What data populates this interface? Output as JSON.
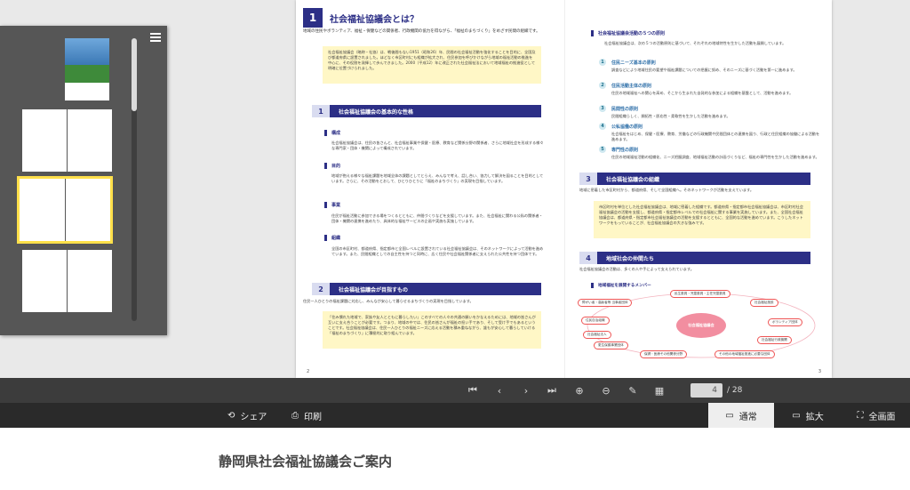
{
  "left_page": {
    "heading_num": "1",
    "heading": "社会福祉協議会とは？",
    "lead": "地域の住民やボランティア、福祉・保健などの関係者、行政機関の協力を得ながら、「福祉のまちづくり」をめざす民間の組織です。",
    "yellow_text": "社会福祉協議会（略称・社協）は、戦後間もない1951（昭和26）年、民間の社会福祉活動を強化することを目的に、全国及び都道府県に設置されました。ほどなく市区町村にも組織が拡大され、住民参加を呼びかけながら地域の福祉活動の推進を中心に、その役割を発揮して歩んできました。2000（平成12）年に改正された社会福祉法において地域福祉の推進役として明確に位置づけられました。",
    "sec1_num": "1",
    "sec1_title": "社会福祉協議会の基本的な性格",
    "sub1": "構成",
    "sub1_text": "社会福祉協議会は、住民の皆さんと、社会福祉事業や保健・医療、教育など関係分野の関係者、さらに地域社会を形成する様々な専門家・団体・機関によって構成されています。",
    "sub2": "目的",
    "sub2_text": "地域が抱える様々な福祉課題を地域全体の課題としてとらえ、みんなで考え、話し合い、協力して解決を図ることを目的としています。さらに、その活動をとおして、ひとりひとりに「福祉のまちづくり」の実現を目指しています。",
    "sub3": "事業",
    "sub3_text": "住民が福祉活動に参加できる場をつくるとともに、仲間づくりなどを支援しています。また、社会福祉に関わる公私の関係者・団体・機関の連携を進めたり、具体的な福祉サービスの企画や実施も実施しています。",
    "sub4": "組織",
    "sub4_text": "全国の市区町村、都道府県、指定都市と全国レベルに設置されている社会福祉協議会は、そのネットワークによって活動を進めています。また、民間組織としての自主性を持つと同時に、広く住民や社会福祉関係者に支えられた公共性を持つ団体です。",
    "sec2_num": "2",
    "sec2_title": "社会福祉協議会が目指すもの",
    "sec2_lead": "住民一人ひとりの福祉課題に対応し、みんなが安心して暮らせるまちづくりの実現を目指しています。",
    "yellow2_text": "「住み慣れた地域で、家族や友人とともに暮らしたい」このすべての人々の共通の願いをかなえるためには、地域の皆さんが互いに支え合うことが必要です。つまり、地域の中では、住民の皆さんが福祉の担い手であり、そして受け手でもあるということです。社会福祉協議会は、住民一人ひとりの福祉ニーズに応える活動を積み重ねながら、誰もが安心して暮らしていける「福祉のまちづくり」に積極的に取り組んでいます。",
    "page_number": "2"
  },
  "right_page": {
    "sec_principle": "社会福祉協議会活動の５つの原則",
    "principle_lead": "社会福祉協議会は、次の５つの活動原則に基づいて、それぞれの地域特性を生かした活動を展開しています。",
    "principles": [
      {
        "num": "1",
        "label": "住民ニーズ基本の原則",
        "text": "調査などにより地域住民の要望や福祉課題についての把握に努め、そのニーズに基づく活動を第一に進めます。"
      },
      {
        "num": "2",
        "label": "住民活動主体の原則",
        "text": "住民の地域福祉への関心を高め、そこから生まれた自発的な参加による組織を基盤として、活動を進めます。"
      },
      {
        "num": "3",
        "label": "民間性の原則",
        "text": "民間組織らしく、開拓性・即応性・柔軟性を生かした活動を進めます。"
      },
      {
        "num": "4",
        "label": "公私協働の原則",
        "text": "社会福祉をはじめ、保健・医療、教育、労働などの行政機関や民間団体との連携を図り、行政と住民組織の協働による活動を進めます。"
      },
      {
        "num": "5",
        "label": "専門性の原則",
        "text": "住民の地域福祉活動の組織化、ニーズ把握調査、地域福祉活動の計画づくりなど、福祉の専門性を生かした活動を進めます。"
      }
    ],
    "sec3_num": "3",
    "sec3_title": "社会福祉協議会の組織",
    "sec3_lead": "地域に密着した市区町村から、都道府県、そして全国組織へ。そのネットワークが活動を支えています。",
    "yellow3_text": "市区町村を単位とした社会福祉協議会は、地域に密着した組織です。都道府県・指定都市社会福祉協議会は、市区町村社会福祉協議会の活動を支援し、都道府県・指定都市レベルでの社会福祉に関する事業を実施しています。また、全国社会福祉協議会は、都道府県・指定都市社会福祉協議会の活動を支援するとともに、全国的な活動を進めています。こうしたネットワークをもっていることが、社会福祉協議会の大きな強みです。",
    "sec4_num": "4",
    "sec4_title": "地域社会の仲間たち",
    "sec4_lead": "社会福祉協議会の活動は、多くの人や手によって支えられています。",
    "map_title": "地域福祉を展開するメンバー",
    "map_center": "社会福祉協議会",
    "map_nodes": [
      "民生委員・児童委員・主任児童委員",
      "社会福祉施設",
      "障がい者・高齢者等 当事者団体",
      "ボランティア団体",
      "住民自治組織",
      "社会福祉法人",
      "更生保護事業団体",
      "社会福祉行政機関",
      "保健・医療その他関係分野",
      "その他の地域福祉推進に必要な団体"
    ],
    "page_number": "3"
  },
  "toolbar": {
    "current_page": "4",
    "total_pages": "/ 28"
  },
  "bottombar": {
    "share_label": "シェア",
    "print_label": "印刷",
    "view_normal": "通常",
    "view_zoom": "拡大",
    "view_fullscreen": "全画面"
  },
  "footer_title": "静岡県社会福祉協議会ご案内",
  "colors": {
    "navy": "#2c2f86",
    "yellow_box": "#fff7c6",
    "selection": "#ffe04a",
    "toolbar": "#3c3c3c",
    "bottombar": "#2a2a2a"
  }
}
